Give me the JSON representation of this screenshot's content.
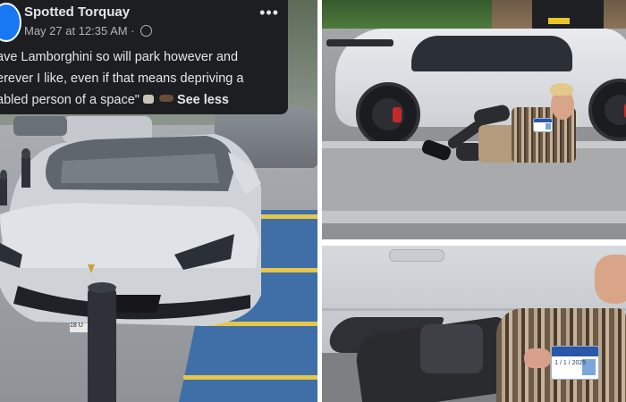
{
  "post": {
    "page_name": "Spotted Torquay",
    "timestamp": "May 27 at 12:35 AM",
    "separator": " · ",
    "more_options": "•••",
    "text_lines": [
      "ave Lamborghini so will park however and",
      "erever I like, even if that means depriving a",
      "abled person of a space\""
    ],
    "see_less_label": "See less"
  },
  "icons": {
    "page_avatar": "page-avatar-logo",
    "privacy": "globe-icon",
    "more": "more-options-icon",
    "emojis": [
      "goat-emoji",
      "emoji-pill"
    ]
  },
  "photos": {
    "left_plate_text": "18 U",
    "disabled_card_text": "1 / 1 / 2025"
  },
  "colors": {
    "fb_card_bg": "#1c1e21",
    "fb_text": "#e4e6eb",
    "fb_muted": "#b0b3b8",
    "car_paint": "#d6d9dd",
    "bay_blue": "#3f6fa6",
    "bay_yellow": "#e6c64b",
    "brake_caliper": "#c52a2a"
  }
}
